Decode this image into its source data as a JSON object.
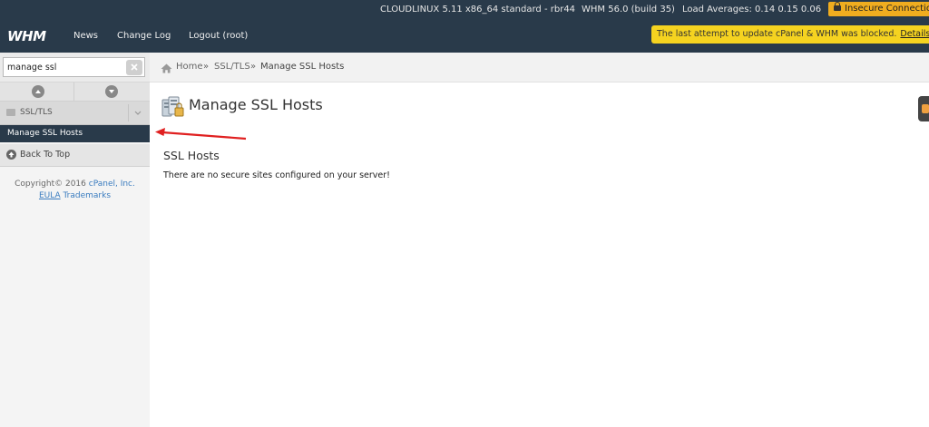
{
  "topbar": {
    "sysinfo": "CLOUDLINUX 5.11 x86_64 standard - rbr44",
    "version": "WHM 56.0 (build 35)",
    "load": "Load Averages: 0.14 0.15 0.06",
    "insecure": "Insecure Connection",
    "logo": "WHM",
    "nav": [
      "News",
      "Change Log",
      "Logout (root)"
    ],
    "alert_text": "The last attempt to update cPanel & WHM was blocked.",
    "alert_link": "Details"
  },
  "sidebar": {
    "search_value": "manage ssl",
    "category": "SSL/TLS",
    "active_item": "Manage SSL Hosts",
    "back_to_top": "Back To Top",
    "copyright_text": "Copyright© 2016",
    "copyright_link": "cPanel, Inc.",
    "eula": "EULA",
    "trademarks": "Trademarks"
  },
  "breadcrumb": {
    "home": "Home",
    "sep": "»",
    "section": "SSL/TLS",
    "current": "Manage SSL Hosts"
  },
  "main": {
    "title": "Manage SSL Hosts",
    "section_title": "SSL Hosts",
    "message": "There are no secure sites configured on your server!"
  },
  "colors": {
    "header_bg": "#293a4a",
    "alert_bg": "#f5d320",
    "insecure_bg": "#f0ad1f",
    "annotation_arrow": "#e02020"
  }
}
